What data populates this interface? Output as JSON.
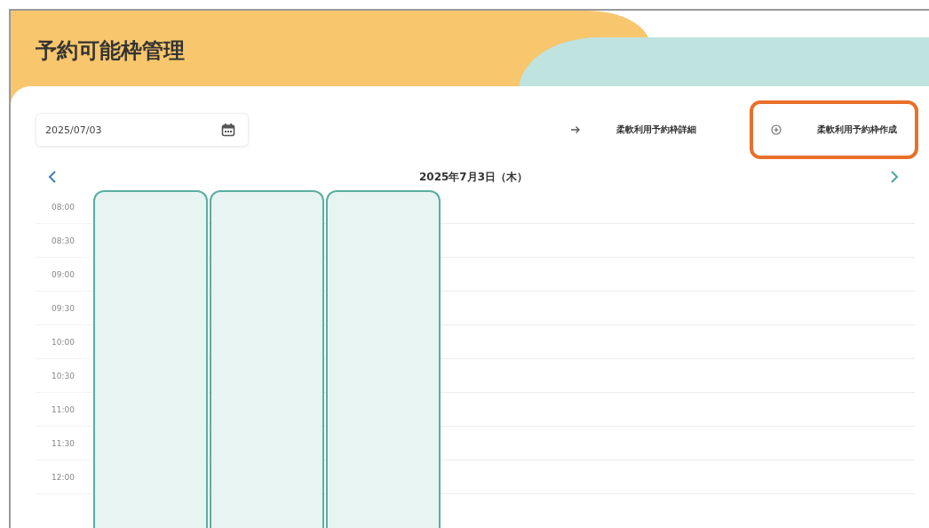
{
  "page": {
    "title": "予約可能枠管理"
  },
  "date_field": {
    "value": "2025/07/03"
  },
  "actions": [
    {
      "label": "柔軟利用予約枠詳細",
      "kind": "arrow",
      "highlighted": false
    },
    {
      "label": "柔軟利用予約枠作成",
      "kind": "plus",
      "highlighted": true
    }
  ],
  "calendar": {
    "date_label": "2025年7月3日（木）",
    "times": [
      "08:00",
      "08:30",
      "09:00",
      "09:30",
      "10:00",
      "10:30",
      "11:00",
      "11:30",
      "12:00"
    ],
    "slots": [
      {
        "kind": "block"
      },
      {
        "kind": "block"
      },
      {
        "kind": "block"
      }
    ]
  }
}
